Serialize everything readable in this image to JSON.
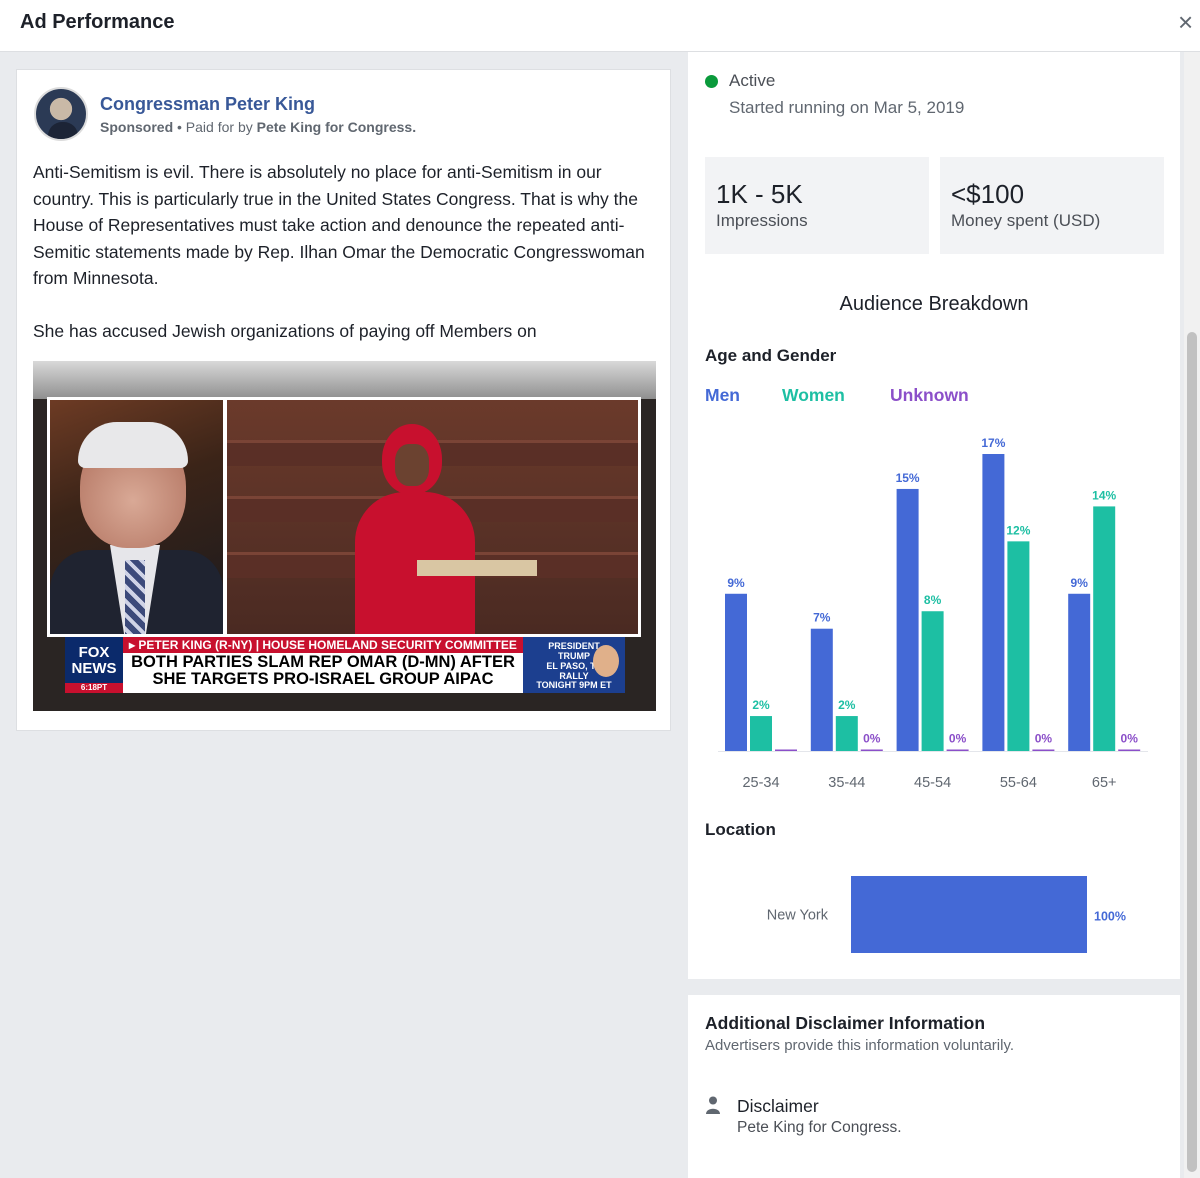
{
  "header": {
    "title": "Ad Performance",
    "close_icon": "×"
  },
  "post": {
    "page_name": "Congressman Peter King",
    "sponsored": "Sponsored",
    "paid_by_prefix": " • Paid for by ",
    "paid_by": "Pete King for Congress.",
    "paragraph_1": "Anti-Semitism is evil. There is absolutely no place for anti-Semitism in our country. This is particularly true in the United States Congress. That is why the House of Representatives must take action and denounce the repeated anti-Semitic statements made by Rep. Ilhan Omar the Democratic Congresswoman from Minnesota.",
    "paragraph_2": "She has accused Jewish organizations of paying off Members on",
    "video": {
      "lower_third_bar": "▸ PETER KING (R-NY) | HOUSE HOMELAND SECURITY COMMITTEE",
      "headline": "BOTH PARTIES SLAM REP OMAR (D-MN) AFTER SHE TARGETS PRO-ISRAEL GROUP AIPAC",
      "logo_line1": "FOX",
      "logo_line2": "NEWS",
      "logo_time": "6:18PT",
      "promo_line1": "PRESIDENT",
      "promo_line2": "TRUMP",
      "promo_line3": "EL PASO, TX",
      "promo_line4": "RALLY",
      "promo_tonight": "TONIGHT 9PM ET"
    }
  },
  "status": {
    "label": "Active",
    "started": "Started running on Mar 5, 2019",
    "color": "#0a9a3b"
  },
  "stats": [
    {
      "value": "1K - 5K",
      "label": "Impressions"
    },
    {
      "value": "<$100",
      "label": "Money spent (USD)"
    }
  ],
  "audience": {
    "title": "Audience Breakdown",
    "age_gender_title": "Age and Gender",
    "legend": [
      {
        "name": "Men",
        "color": "#4469d6"
      },
      {
        "name": "Women",
        "color": "#1dbfa3"
      },
      {
        "name": "Unknown",
        "color": "#8b4fc9"
      }
    ]
  },
  "chart_data": [
    {
      "type": "bar",
      "categories": [
        "25-34",
        "35-44",
        "45-54",
        "55-64",
        "65+"
      ],
      "series": [
        {
          "name": "Men",
          "values": [
            9,
            7,
            15,
            17,
            9
          ],
          "labels": [
            "9%",
            "7%",
            "15%",
            "17%",
            "9%"
          ]
        },
        {
          "name": "Women",
          "values": [
            2,
            2,
            8,
            12,
            14
          ],
          "labels": [
            "2%",
            "2%",
            "8%",
            "12%",
            "14%"
          ]
        },
        {
          "name": "Unknown",
          "values": [
            0,
            0,
            0,
            0,
            0
          ],
          "labels": [
            "",
            "0%",
            "0%",
            "0%",
            "0%"
          ]
        }
      ],
      "ylim": [
        0,
        17
      ]
    },
    {
      "type": "bar",
      "orientation": "horizontal",
      "categories": [
        "New York"
      ],
      "values": [
        100
      ],
      "labels": [
        "100%"
      ],
      "title": "Location"
    }
  ],
  "location": {
    "title": "Location"
  },
  "disclaimer": {
    "title": "Additional Disclaimer Information",
    "subtitle": "Advertisers provide this information voluntarily.",
    "icon": "person-icon",
    "label": "Disclaimer",
    "value": "Pete King for Congress."
  }
}
